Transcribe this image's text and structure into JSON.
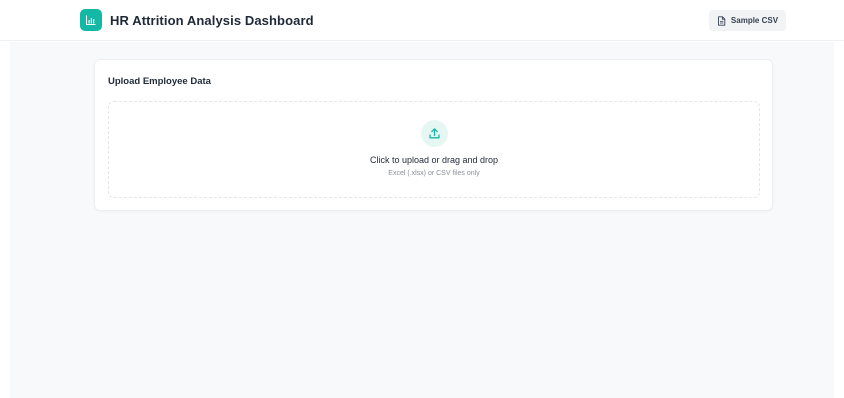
{
  "header": {
    "title": "HR Attrition Analysis Dashboard",
    "logo_icon": "bar-chart-icon",
    "sample_button": {
      "label": "Sample CSV",
      "icon": "file-text-icon"
    }
  },
  "upload_card": {
    "title": "Upload Employee Data",
    "dropzone": {
      "icon": "upload-icon",
      "primary_text": "Click to upload or drag and drop",
      "secondary_text": "Excel (.xlsx) or CSV files only"
    }
  },
  "colors": {
    "accent": "#14b8a6",
    "accent_soft": "#e6f7f3",
    "page_bg": "#f8f9fb"
  }
}
